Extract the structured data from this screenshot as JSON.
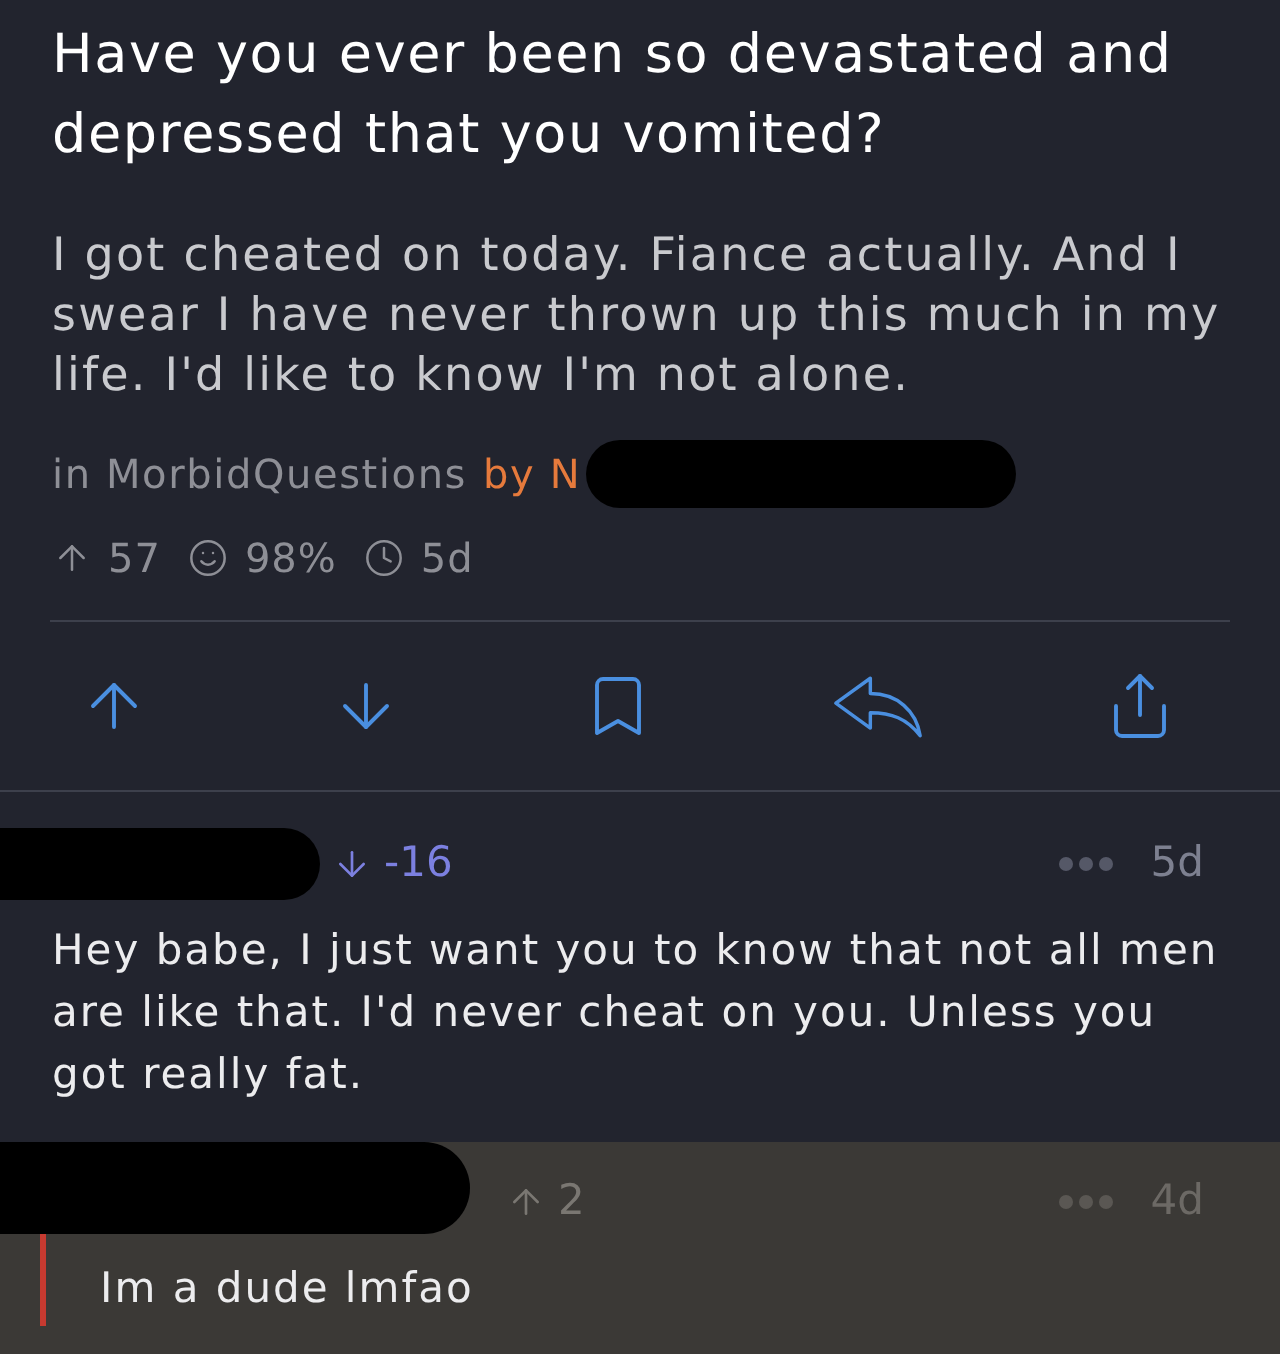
{
  "post": {
    "title": "Have you ever been so devastated and depressed that you vomited?",
    "body": "I got cheated on today. Fiance actually. And I swear I have never thrown up this much in my life. I'd like to know I'm not alone.",
    "subreddit": "in MorbidQuestions",
    "author": "by N",
    "stats": [
      {
        "kind": "score",
        "text": "57"
      },
      {
        "kind": "ratio",
        "text": "98%"
      },
      {
        "kind": "age",
        "text": "5d"
      }
    ]
  },
  "actions": [
    {
      "kind": "upvote"
    },
    {
      "kind": "downvote"
    },
    {
      "kind": "save"
    },
    {
      "kind": "reply"
    },
    {
      "kind": "share"
    }
  ],
  "comments": [
    {
      "kind": "downvoted",
      "score": "-16",
      "age": "5d",
      "body": "Hey babe, I just want you to know that not all men are like that. I'd never cheat on you. Unless you got really fat.",
      "selected": false,
      "children": [
        {
          "kind": "upvoted",
          "score": "2",
          "age": "4d",
          "body": "Im a dude lmfao",
          "selected": true
        }
      ]
    }
  ]
}
